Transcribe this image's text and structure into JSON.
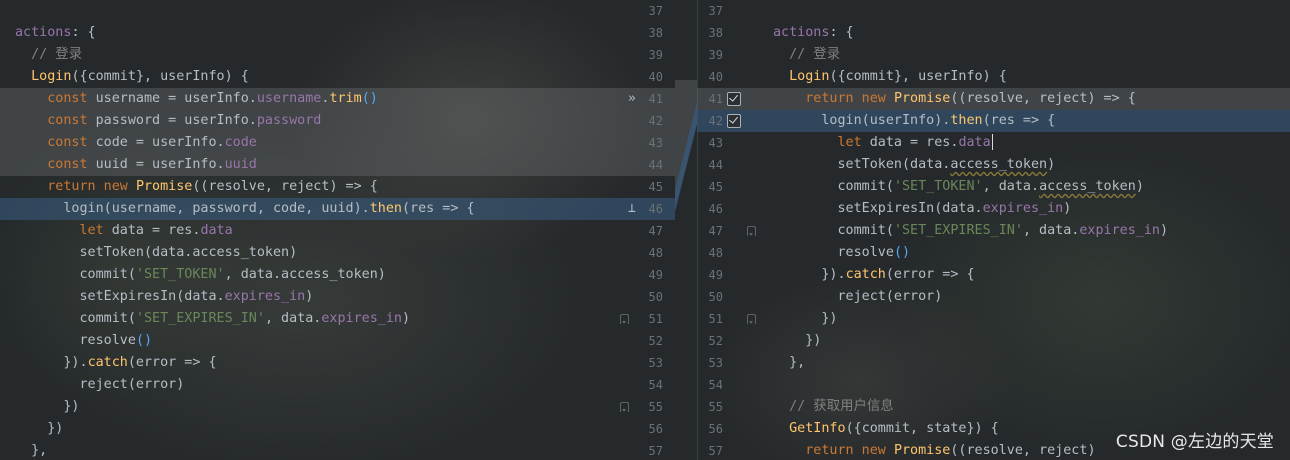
{
  "left_pane": {
    "lines": [
      {
        "num": "37",
        "tokens": []
      },
      {
        "num": "38",
        "tokens": [
          {
            "t": "actions",
            "c": "prop"
          },
          {
            "t": ": {",
            "c": "plain"
          }
        ]
      },
      {
        "num": "39",
        "tokens": [
          {
            "t": "  // 登录",
            "c": "cmt"
          }
        ]
      },
      {
        "num": "40",
        "tokens": [
          {
            "t": "  Login",
            "c": "fn"
          },
          {
            "t": "({",
            "c": "plain"
          },
          {
            "t": "commit",
            "c": "plain"
          },
          {
            "t": "}, ",
            "c": "plain"
          },
          {
            "t": "userInfo",
            "c": "plain"
          },
          {
            "t": ") {",
            "c": "plain"
          }
        ]
      },
      {
        "num": "41",
        "hl": "gray",
        "tokens": [
          {
            "t": "    const ",
            "c": "kw"
          },
          {
            "t": "username = userInfo.",
            "c": "plain"
          },
          {
            "t": "username",
            "c": "prop"
          },
          {
            "t": ".",
            "c": "plain"
          },
          {
            "t": "trim",
            "c": "fn"
          },
          {
            "t": "()",
            "c": "paren"
          }
        ]
      },
      {
        "num": "42",
        "hl": "gray",
        "tokens": [
          {
            "t": "    const ",
            "c": "kw"
          },
          {
            "t": "password = userInfo.",
            "c": "plain"
          },
          {
            "t": "password",
            "c": "prop"
          }
        ]
      },
      {
        "num": "43",
        "hl": "gray",
        "tokens": [
          {
            "t": "    const ",
            "c": "kw"
          },
          {
            "t": "code = userInfo.",
            "c": "plain"
          },
          {
            "t": "code",
            "c": "prop"
          }
        ]
      },
      {
        "num": "44",
        "hl": "gray",
        "tokens": [
          {
            "t": "    const ",
            "c": "kw"
          },
          {
            "t": "uuid = userInfo.",
            "c": "plain"
          },
          {
            "t": "uuid",
            "c": "prop"
          }
        ]
      },
      {
        "num": "45",
        "tokens": [
          {
            "t": "    return new ",
            "c": "kw"
          },
          {
            "t": "Promise",
            "c": "fn"
          },
          {
            "t": "((",
            "c": "plain"
          },
          {
            "t": "resolve, reject",
            "c": "plain"
          },
          {
            "t": ") => {",
            "c": "plain"
          }
        ]
      },
      {
        "num": "46",
        "hl": "blue",
        "tokens": [
          {
            "t": "      login(",
            "c": "plain"
          },
          {
            "t": "username, password, code, uuid",
            "c": "plain"
          },
          {
            "t": ").",
            "c": "plain"
          },
          {
            "t": "then",
            "c": "fn"
          },
          {
            "t": "(res => {",
            "c": "plain"
          }
        ]
      },
      {
        "num": "47",
        "tokens": [
          {
            "t": "        let ",
            "c": "kw"
          },
          {
            "t": "data = res.",
            "c": "plain"
          },
          {
            "t": "data",
            "c": "prop"
          }
        ]
      },
      {
        "num": "48",
        "tokens": [
          {
            "t": "        setToken(data.access_token)",
            "c": "plain"
          }
        ]
      },
      {
        "num": "49",
        "tokens": [
          {
            "t": "        commit(",
            "c": "plain"
          },
          {
            "t": "'SET_TOKEN'",
            "c": "str"
          },
          {
            "t": ", data.access_token)",
            "c": "plain"
          }
        ]
      },
      {
        "num": "50",
        "tokens": [
          {
            "t": "        setExpiresIn(data.",
            "c": "plain"
          },
          {
            "t": "expires_in",
            "c": "prop"
          },
          {
            "t": ")",
            "c": "plain"
          }
        ]
      },
      {
        "num": "51",
        "tokens": [
          {
            "t": "        commit(",
            "c": "plain"
          },
          {
            "t": "'SET_EXPIRES_IN'",
            "c": "str"
          },
          {
            "t": ", data.",
            "c": "plain"
          },
          {
            "t": "expires_in",
            "c": "prop"
          },
          {
            "t": ")",
            "c": "plain"
          }
        ]
      },
      {
        "num": "52",
        "tokens": [
          {
            "t": "        resolve",
            "c": "plain"
          },
          {
            "t": "()",
            "c": "paren"
          }
        ]
      },
      {
        "num": "53",
        "tokens": [
          {
            "t": "      }).",
            "c": "plain"
          },
          {
            "t": "catch",
            "c": "fn"
          },
          {
            "t": "(error => {",
            "c": "plain"
          }
        ]
      },
      {
        "num": "54",
        "tokens": [
          {
            "t": "        reject(error)",
            "c": "plain"
          }
        ]
      },
      {
        "num": "55",
        "tokens": [
          {
            "t": "      })",
            "c": "plain"
          }
        ]
      },
      {
        "num": "56",
        "tokens": [
          {
            "t": "    })",
            "c": "plain"
          }
        ]
      },
      {
        "num": "57",
        "tokens": [
          {
            "t": "  },",
            "c": "plain"
          }
        ]
      }
    ]
  },
  "right_pane": {
    "lines": [
      {
        "num": "37",
        "tokens": []
      },
      {
        "num": "38",
        "tokens": [
          {
            "t": "actions",
            "c": "prop"
          },
          {
            "t": ": {",
            "c": "plain"
          }
        ]
      },
      {
        "num": "39",
        "tokens": [
          {
            "t": "  // 登录",
            "c": "cmt"
          }
        ]
      },
      {
        "num": "40",
        "tokens": [
          {
            "t": "  Login",
            "c": "fn"
          },
          {
            "t": "({",
            "c": "plain"
          },
          {
            "t": "commit",
            "c": "plain"
          },
          {
            "t": "}, userInfo) {",
            "c": "plain"
          }
        ]
      },
      {
        "num": "41",
        "hl": "gray",
        "tokens": [
          {
            "t": "    return new ",
            "c": "kw"
          },
          {
            "t": "Promise",
            "c": "fn"
          },
          {
            "t": "((",
            "c": "plain"
          },
          {
            "t": "resolve, reject",
            "c": "plain"
          },
          {
            "t": ") => {",
            "c": "plain"
          }
        ]
      },
      {
        "num": "42",
        "hl": "blue",
        "tokens": [
          {
            "t": "      login(",
            "c": "plain"
          },
          {
            "t": "userInfo",
            "c": "plain"
          },
          {
            "t": ").",
            "c": "plain"
          },
          {
            "t": "then",
            "c": "fn"
          },
          {
            "t": "(res => {",
            "c": "plain"
          }
        ]
      },
      {
        "num": "43",
        "tokens": [
          {
            "t": "        let ",
            "c": "kw"
          },
          {
            "t": "data = res.",
            "c": "plain"
          },
          {
            "t": "data",
            "c": "prop"
          }
        ],
        "caret": true
      },
      {
        "num": "44",
        "tokens": [
          {
            "t": "        setToken(data.",
            "c": "plain"
          },
          {
            "t": "access_token",
            "c": "plain",
            "u": true
          },
          {
            "t": ")",
            "c": "plain"
          }
        ]
      },
      {
        "num": "45",
        "tokens": [
          {
            "t": "        commit(",
            "c": "plain"
          },
          {
            "t": "'SET_TOKEN'",
            "c": "str"
          },
          {
            "t": ", data.",
            "c": "plain"
          },
          {
            "t": "access_token",
            "c": "plain",
            "u": true
          },
          {
            "t": ")",
            "c": "plain"
          }
        ]
      },
      {
        "num": "46",
        "tokens": [
          {
            "t": "        setExpiresIn(data.",
            "c": "plain"
          },
          {
            "t": "expires_in",
            "c": "prop"
          },
          {
            "t": ")",
            "c": "plain"
          }
        ]
      },
      {
        "num": "47",
        "tokens": [
          {
            "t": "        commit(",
            "c": "plain"
          },
          {
            "t": "'SET_EXPIRES_IN'",
            "c": "str"
          },
          {
            "t": ", data.",
            "c": "plain"
          },
          {
            "t": "expires_in",
            "c": "prop"
          },
          {
            "t": ")",
            "c": "plain"
          }
        ]
      },
      {
        "num": "48",
        "tokens": [
          {
            "t": "        resolve",
            "c": "plain"
          },
          {
            "t": "()",
            "c": "paren"
          }
        ]
      },
      {
        "num": "49",
        "tokens": [
          {
            "t": "      }).",
            "c": "plain"
          },
          {
            "t": "catch",
            "c": "fn"
          },
          {
            "t": "(error => {",
            "c": "plain"
          }
        ]
      },
      {
        "num": "50",
        "tokens": [
          {
            "t": "        reject(error)",
            "c": "plain"
          }
        ]
      },
      {
        "num": "51",
        "tokens": [
          {
            "t": "      })",
            "c": "plain"
          }
        ]
      },
      {
        "num": "52",
        "tokens": [
          {
            "t": "    })",
            "c": "plain"
          }
        ]
      },
      {
        "num": "53",
        "tokens": [
          {
            "t": "  },",
            "c": "plain"
          }
        ]
      },
      {
        "num": "54",
        "tokens": []
      },
      {
        "num": "55",
        "tokens": [
          {
            "t": "  // 获取用户信息",
            "c": "cmt"
          }
        ]
      },
      {
        "num": "56",
        "tokens": [
          {
            "t": "  GetInfo",
            "c": "fn"
          },
          {
            "t": "({",
            "c": "plain"
          },
          {
            "t": "commit, state",
            "c": "plain"
          },
          {
            "t": "}) {",
            "c": "plain"
          }
        ]
      },
      {
        "num": "57",
        "tokens": [
          {
            "t": "    return new ",
            "c": "kw"
          },
          {
            "t": "Promise",
            "c": "fn"
          },
          {
            "t": "((",
            "c": "plain"
          },
          {
            "t": "resolve, reject",
            "c": "plain"
          },
          {
            "t": ")",
            "c": "plain"
          }
        ]
      }
    ]
  },
  "left_gutter_markers": {
    "41": "»",
    "46": "⊥"
  },
  "left_fold_lines": [
    "51",
    "55"
  ],
  "right_checkbox_lines": [
    "41",
    "42"
  ],
  "right_fold_lines": [
    "47",
    "51"
  ],
  "watermark": "CSDN @左边的天堂"
}
